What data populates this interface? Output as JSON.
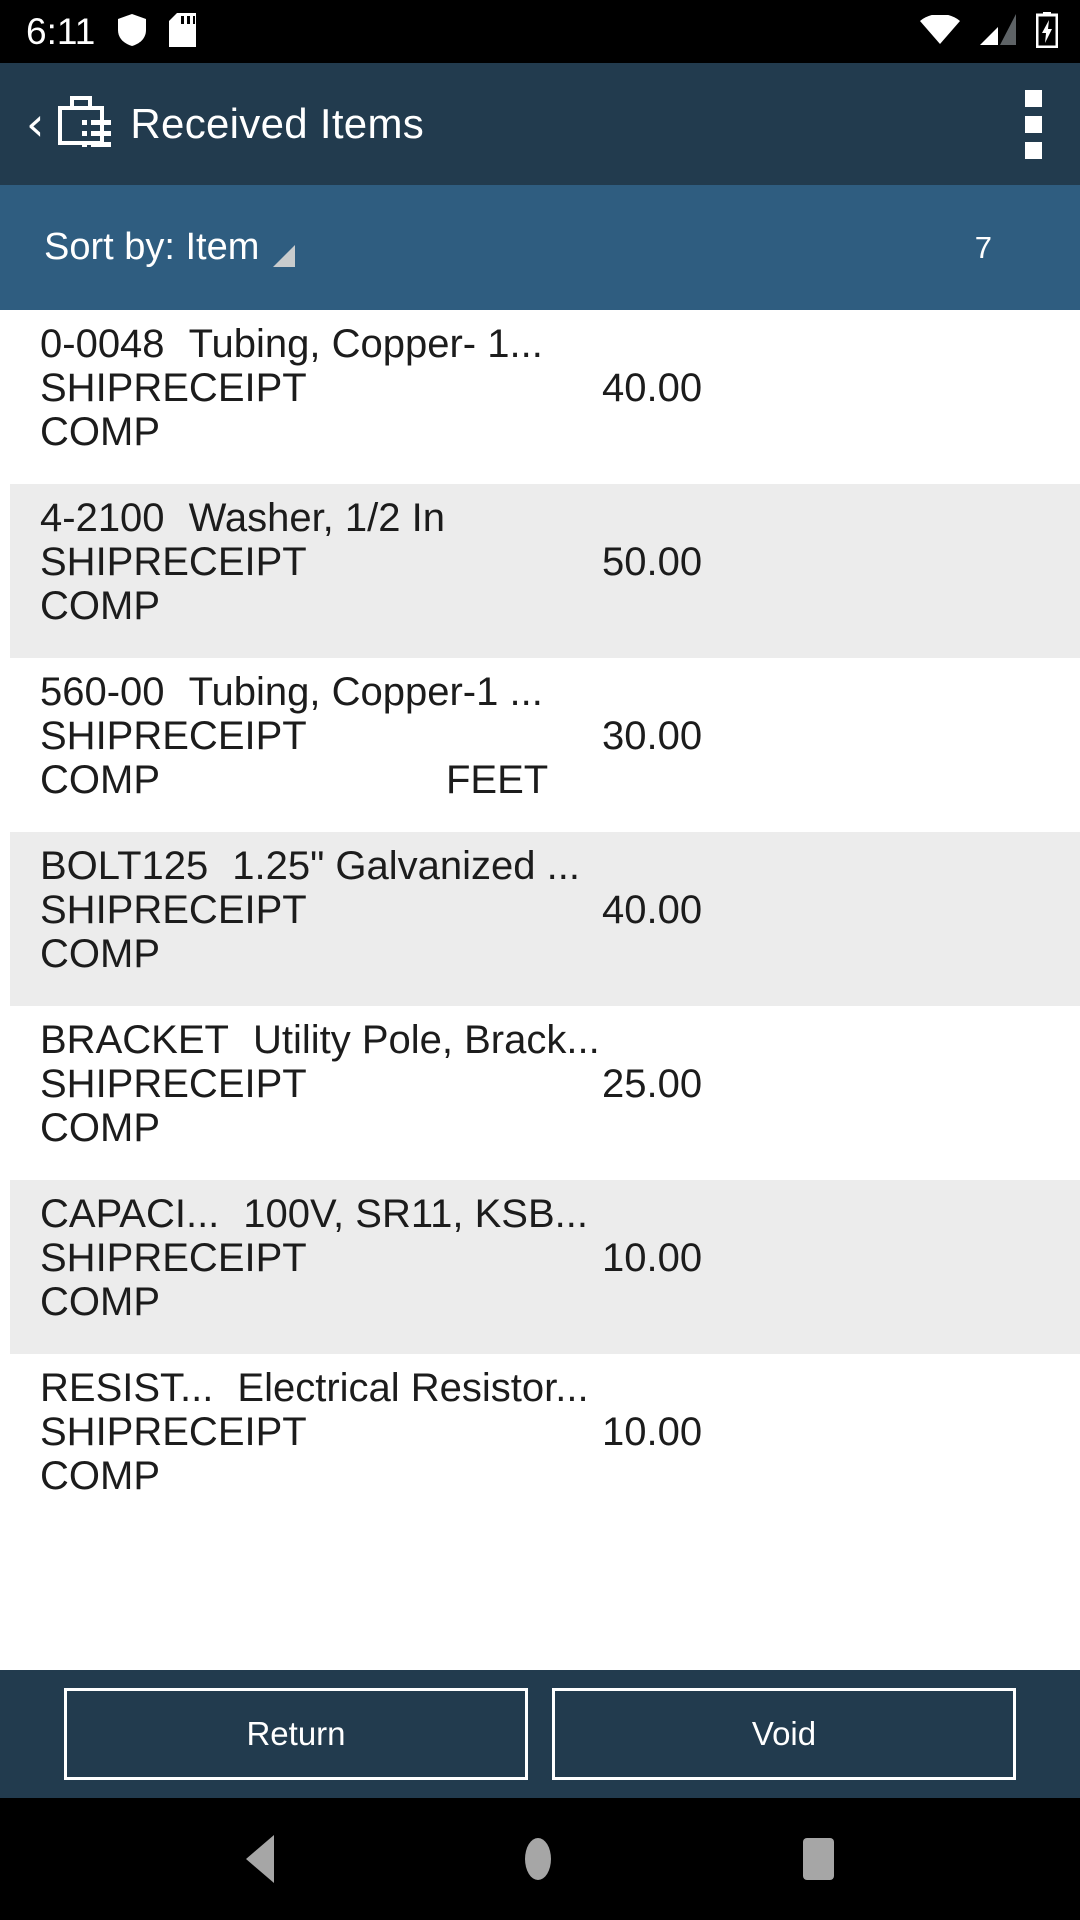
{
  "status_bar": {
    "time": "6:11",
    "icons_left": [
      "shield-icon",
      "sd-card-icon"
    ],
    "icons_right": [
      "wifi-icon",
      "cellular-signal-icon",
      "battery-charging-icon"
    ]
  },
  "app_bar": {
    "back_label": "‹",
    "icon": "receipt-list-icon",
    "title": "Received Items",
    "overflow": "more-options-icon"
  },
  "sort_bar": {
    "label": "Sort by: Item",
    "caret": "sort-caret-icon",
    "count": "7"
  },
  "list": {
    "rows": [
      {
        "item": "0-0048",
        "desc": "Tubing, Copper- 1...",
        "status": "SHIPRECEIPT",
        "qty": "40.00",
        "state": "COMP",
        "unit": ""
      },
      {
        "item": "4-2100",
        "desc": "Washer, 1/2 In",
        "status": "SHIPRECEIPT",
        "qty": "50.00",
        "state": "COMP",
        "unit": ""
      },
      {
        "item": "560-00",
        "desc": "Tubing, Copper-1 ...",
        "status": "SHIPRECEIPT",
        "qty": "30.00",
        "state": "COMP",
        "unit": "FEET"
      },
      {
        "item": "BOLT125",
        "desc": "1.25\" Galvanized ...",
        "status": "SHIPRECEIPT",
        "qty": "40.00",
        "state": "COMP",
        "unit": ""
      },
      {
        "item": "BRACKET",
        "desc": "Utility Pole, Brack...",
        "status": "SHIPRECEIPT",
        "qty": "25.00",
        "state": "COMP",
        "unit": ""
      },
      {
        "item": "CAPACI...",
        "desc": "100V, SR11, KSB...",
        "status": "SHIPRECEIPT",
        "qty": "10.00",
        "state": "COMP",
        "unit": ""
      },
      {
        "item": "RESIST...",
        "desc": "Electrical Resistor...",
        "status": "SHIPRECEIPT",
        "qty": "10.00",
        "state": "COMP",
        "unit": ""
      }
    ]
  },
  "action_bar": {
    "return_label": "Return",
    "void_label": "Void"
  },
  "nav_bar": {
    "back": "nav-back-icon",
    "home": "nav-home-icon",
    "recents": "nav-recents-icon"
  },
  "colors": {
    "app_bar": "#223b4e",
    "sort_bar": "#2f5d80",
    "row_alt": "#ececec",
    "status_bar": "#000000",
    "text_light": "#ffffff",
    "text_dark": "#1c1c1c",
    "nav_icon": "#a6a6a6"
  }
}
